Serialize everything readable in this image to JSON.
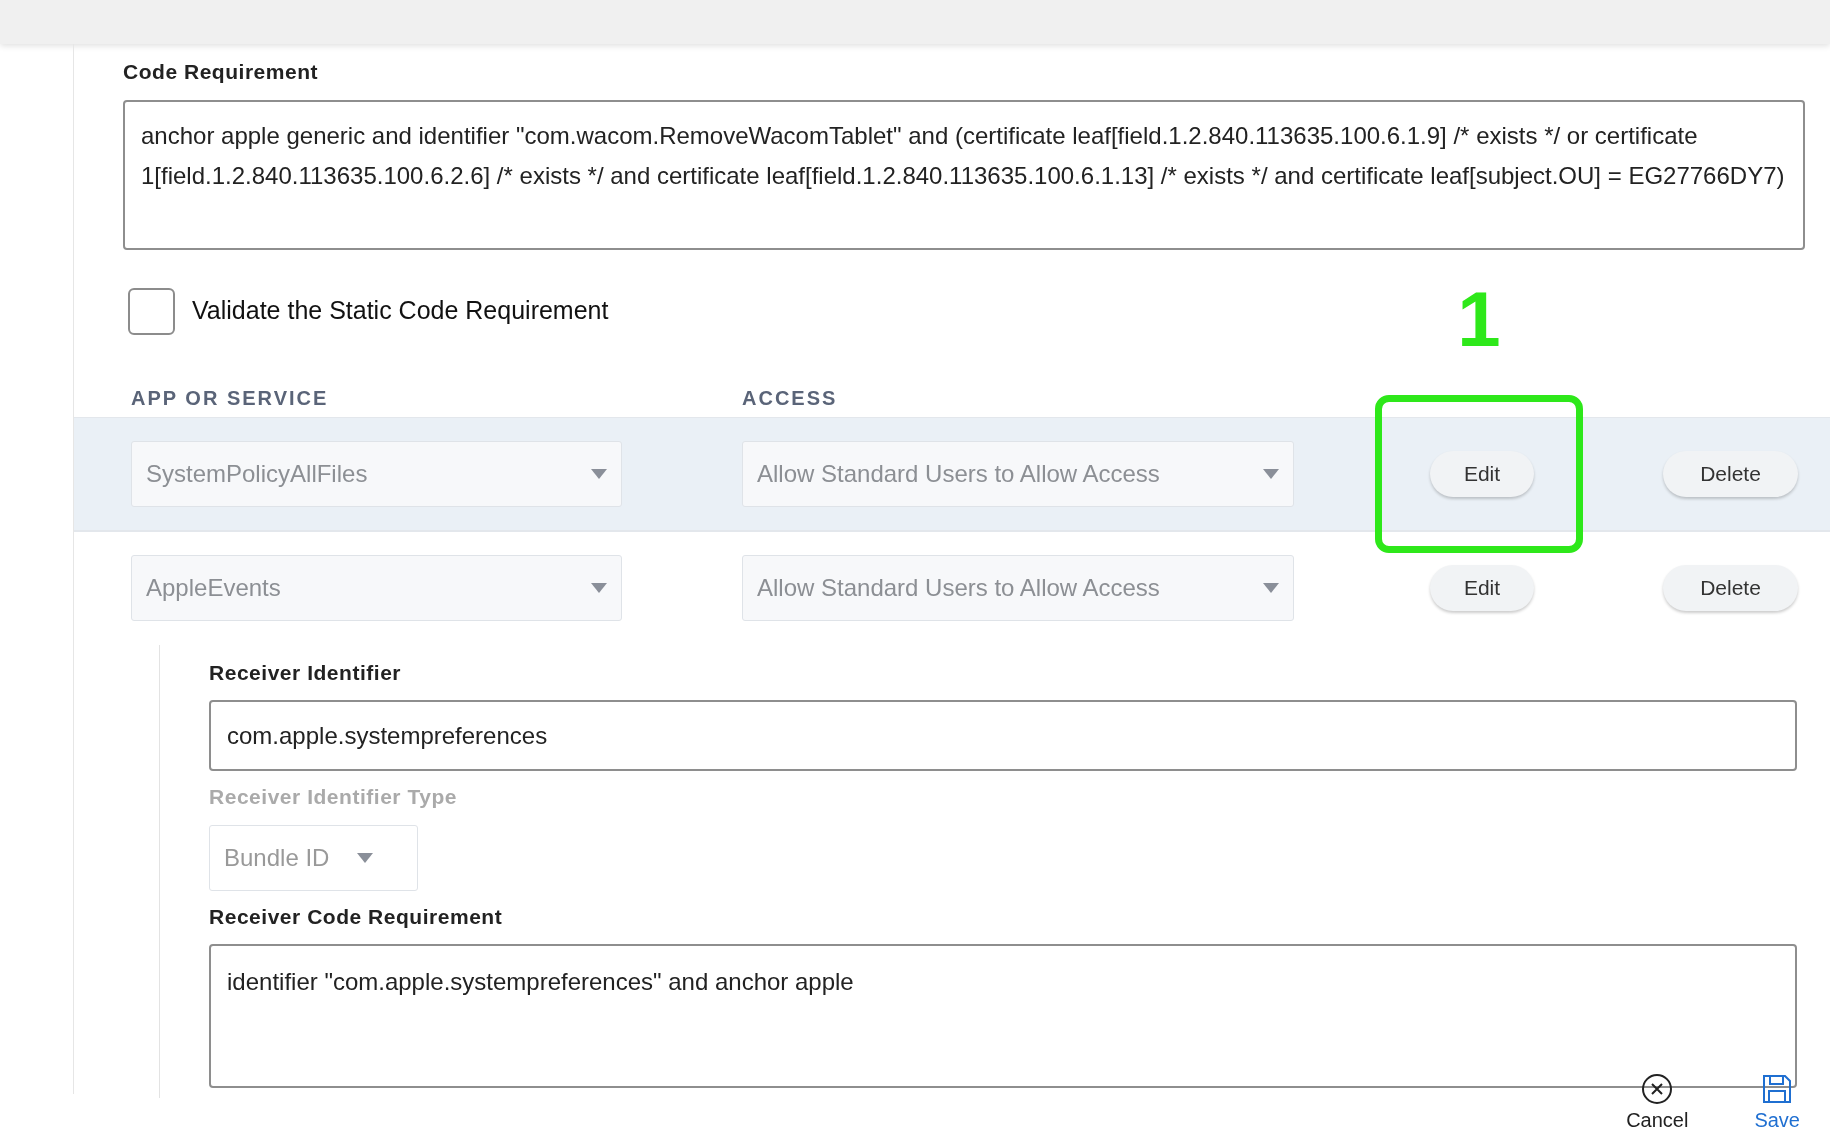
{
  "code_requirement": {
    "label": "Code Requirement",
    "value": "anchor apple generic and identifier \"com.wacom.RemoveWacomTablet\" and (certificate leaf[field.1.2.840.113635.100.6.1.9] /* exists */ or certificate 1[field.1.2.840.113635.100.6.2.6] /* exists */ and certificate leaf[field.1.2.840.113635.100.6.1.13] /* exists */ and certificate leaf[subject.OU] = EG27766DY7)"
  },
  "validate_checkbox": {
    "label": "Validate the Static Code Requirement",
    "checked": false
  },
  "annotation": {
    "label": "1"
  },
  "table": {
    "columns": [
      "APP OR SERVICE",
      "ACCESS"
    ],
    "rows": [
      {
        "app": "SystemPolicyAllFiles",
        "access": "Allow Standard Users to Allow Access",
        "edit": "Edit",
        "delete": "Delete",
        "selected": true
      },
      {
        "app": "AppleEvents",
        "access": "Allow Standard Users to Allow Access",
        "edit": "Edit",
        "delete": "Delete",
        "selected": false,
        "details": {
          "receiver_identifier": {
            "label": "Receiver Identifier",
            "value": "com.apple.systempreferences"
          },
          "receiver_identifier_type": {
            "label": "Receiver Identifier Type",
            "value": "Bundle ID",
            "disabled": true
          },
          "receiver_code_requirement": {
            "label": "Receiver Code Requirement",
            "value": "identifier \"com.apple.systempreferences\" and anchor apple"
          }
        }
      }
    ]
  },
  "footer": {
    "buttons": [
      {
        "kind": "cancel",
        "label": "Cancel"
      },
      {
        "kind": "save",
        "label": "Save"
      }
    ]
  }
}
